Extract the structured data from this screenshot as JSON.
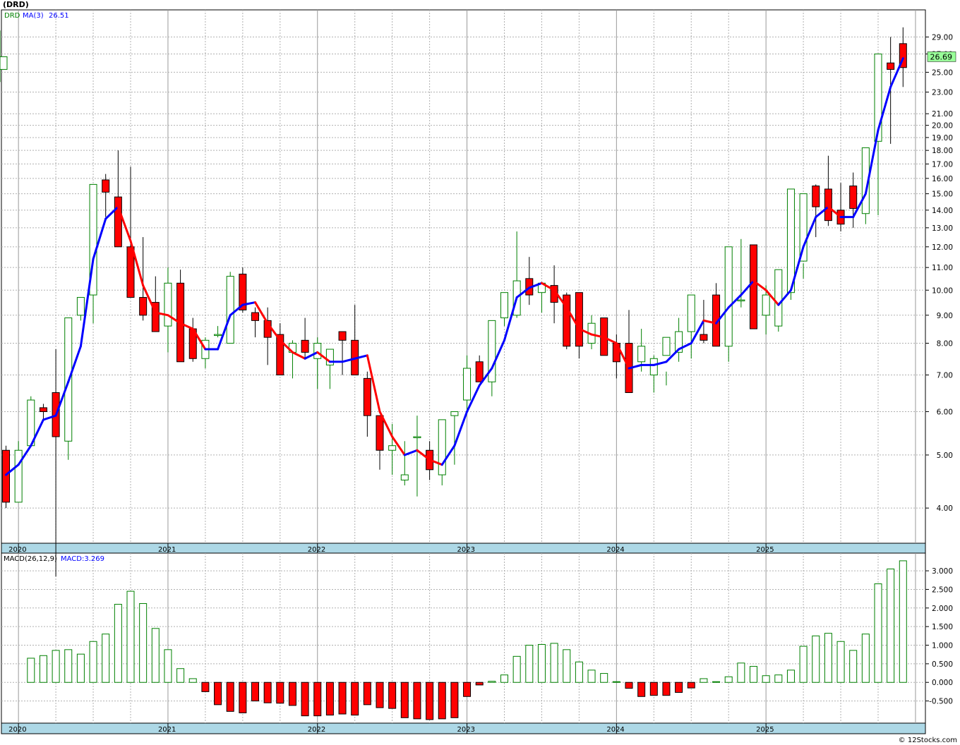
{
  "ticker_label": "(DRD)",
  "credit": "© 12Stocks.com",
  "price_legend": {
    "symbol": "DRD",
    "ma_label": "MA(3)",
    "ma_value": "26.51"
  },
  "last_price_label": "26.69",
  "macd_legend": {
    "label": "MACD(26,12,9)",
    "value_label": "MACD:3.269"
  },
  "year_labels": [
    "2020",
    "2021",
    "2022",
    "2023",
    "2024",
    "2025"
  ],
  "colors": {
    "up_candle": "#008000",
    "down_candle": "#ff0000",
    "ma_up": "#0000ff",
    "ma_down": "#ff0000",
    "axis_band": "#add8e6",
    "grid": "#b0b0b0"
  },
  "chart_data": [
    {
      "type": "candlestick",
      "scale": "log",
      "interval": "monthly",
      "ylim": [
        3.5,
        30.0
      ],
      "y_ticks": [
        "4.00",
        "5.00",
        "6.00",
        "7.00",
        "8.00",
        "9.00",
        "10.00",
        "11.00",
        "12.00",
        "13.00",
        "14.00",
        "15.00",
        "16.00",
        "17.00",
        "18.00",
        "19.00",
        "20.00",
        "21.00",
        "23.00",
        "25.00",
        "27.00",
        "29.00"
      ],
      "x_ticks": [
        "2020",
        "2021",
        "2022",
        "2023",
        "2024",
        "2025"
      ],
      "x": [
        "2019-12",
        "2020-01",
        "2020-02",
        "2020-03",
        "2020-04",
        "2020-05",
        "2020-06",
        "2020-07",
        "2020-08",
        "2020-09",
        "2020-10",
        "2020-11",
        "2020-12",
        "2021-01",
        "2021-02",
        "2021-03",
        "2021-04",
        "2021-05",
        "2021-06",
        "2021-07",
        "2021-08",
        "2021-09",
        "2021-10",
        "2021-11",
        "2021-12",
        "2022-01",
        "2022-02",
        "2022-03",
        "2022-04",
        "2022-05",
        "2022-06",
        "2022-07",
        "2022-08",
        "2022-09",
        "2022-10",
        "2022-11",
        "2022-12",
        "2023-01",
        "2023-02",
        "2023-03",
        "2023-04",
        "2023-05",
        "2023-06",
        "2023-07",
        "2023-08",
        "2023-09",
        "2023-10",
        "2023-11",
        "2023-12",
        "2024-01",
        "2024-02",
        "2024-03",
        "2024-04",
        "2024-05",
        "2024-06",
        "2024-07",
        "2024-08",
        "2024-09",
        "2024-10",
        "2024-11",
        "2024-12",
        "2025-01",
        "2025-02",
        "2025-03",
        "2025-04",
        "2025-05",
        "2025-06",
        "2025-07",
        "2025-08",
        "2025-09",
        "2025-10",
        "2025-11",
        "2025-12"
      ],
      "open": [
        5.1,
        4.1,
        5.2,
        6.1,
        6.5,
        5.3,
        9.0,
        9.8,
        15.9,
        14.8,
        12.0,
        9.7,
        9.5,
        8.6,
        10.3,
        8.5,
        7.5,
        8.3,
        8.0,
        10.7,
        9.1,
        8.8,
        8.3,
        7.7,
        8.1,
        7.5,
        7.3,
        8.4,
        8.1,
        6.9,
        5.9,
        5.1,
        4.5,
        5.4,
        5.1,
        4.6,
        5.9,
        6.3,
        7.4,
        6.8,
        8.9,
        9.0,
        10.5,
        9.9,
        10.2,
        9.8,
        9.9,
        8.0,
        8.9,
        8.0,
        8.0,
        7.4,
        7.0,
        7.6,
        7.7,
        8.4,
        8.3,
        9.8,
        7.9,
        9.6,
        12.1,
        9.0,
        8.6,
        9.9,
        11.3,
        15.5,
        15.3,
        14.0,
        15.5,
        13.8,
        18.7,
        26.0,
        28.2,
        25.3
      ],
      "high": [
        5.2,
        5.3,
        6.4,
        6.2,
        7.8,
        7.8,
        9.7,
        10.5,
        16.3,
        18.0,
        16.8,
        12.5,
        10.6,
        11.0,
        10.9,
        8.9,
        8.2,
        8.6,
        10.8,
        11.0,
        9.3,
        9.3,
        8.7,
        8.1,
        8.9,
        8.2,
        7.7,
        8.1,
        9.4,
        7.1,
        5.9,
        5.7,
        5.3,
        5.9,
        5.3,
        5.1,
        6.0,
        7.6,
        7.6,
        7.2,
        9.8,
        12.8,
        11.5,
        10.3,
        11.1,
        9.9,
        9.1,
        9.0,
        8.4,
        8.3,
        9.2,
        8.5,
        7.6,
        7.1,
        8.9,
        9.1,
        9.6,
        10.3,
        10.1,
        12.4,
        12.1,
        10.2,
        9.0,
        10.2,
        11.2,
        15.6,
        17.6,
        15.7,
        16.4,
        15.0,
        18.8,
        29.0,
        30.2,
        29.8
      ],
      "low": [
        4.0,
        4.1,
        5.2,
        5.8,
        3.0,
        4.9,
        8.8,
        8.7,
        13.6,
        14.2,
        11.3,
        8.8,
        9.1,
        7.7,
        8.3,
        7.4,
        7.2,
        8.2,
        8.0,
        9.1,
        8.2,
        7.3,
        7.0,
        6.9,
        7.5,
        6.6,
        6.6,
        7.0,
        7.0,
        5.4,
        4.7,
        4.6,
        4.4,
        4.2,
        4.5,
        4.4,
        4.8,
        6.0,
        6.9,
        6.4,
        8.6,
        8.9,
        9.4,
        9.1,
        8.7,
        7.8,
        7.5,
        7.8,
        7.6,
        6.9,
        6.6,
        7.1,
        6.5,
        6.7,
        7.4,
        7.5,
        8.0,
        8.4,
        7.4,
        9.3,
        8.9,
        8.3,
        8.4,
        9.6,
        10.5,
        12.5,
        13.1,
        12.8,
        13.0,
        13.2,
        13.7,
        18.5,
        23.5,
        24.0
      ],
      "close": [
        4.1,
        5.1,
        6.3,
        6.0,
        5.4,
        8.9,
        9.7,
        15.6,
        15.1,
        12.0,
        9.7,
        9.0,
        8.4,
        10.3,
        7.4,
        7.5,
        8.1,
        8.3,
        10.6,
        9.2,
        8.8,
        8.2,
        7.0,
        8.0,
        7.7,
        8.0,
        7.8,
        8.1,
        7.0,
        5.9,
        5.1,
        5.2,
        4.6,
        5.4,
        4.7,
        5.8,
        6.0,
        7.2,
        6.8,
        8.8,
        9.9,
        10.4,
        9.8,
        10.3,
        9.5,
        7.9,
        7.9,
        8.7,
        7.6,
        7.4,
        6.5,
        7.9,
        7.5,
        8.2,
        8.4,
        9.8,
        8.1,
        7.9,
        12.0,
        9.6,
        8.5,
        9.8,
        10.9,
        15.3,
        15.0,
        14.2,
        13.4,
        13.2,
        14.1,
        18.2,
        27.0,
        25.3,
        25.5,
        26.69
      ],
      "ma": [
        {
          "name": "MA(3)",
          "values": [
            4.6,
            4.8,
            5.2,
            5.8,
            5.9,
            6.8,
            7.9,
            11.4,
            13.5,
            14.2,
            12.3,
            10.2,
            9.1,
            9.0,
            8.7,
            8.5,
            7.8,
            7.8,
            9.0,
            9.4,
            9.5,
            8.7,
            8.1,
            7.7,
            7.5,
            7.7,
            7.4,
            7.4,
            7.5,
            7.6,
            6.0,
            5.4,
            5.0,
            5.1,
            4.9,
            4.8,
            5.2,
            6.0,
            6.7,
            7.2,
            8.1,
            9.7,
            10.1,
            10.3,
            10.0,
            9.3,
            8.5,
            8.3,
            8.2,
            8.0,
            7.2,
            7.3,
            7.3,
            7.4,
            7.8,
            8.0,
            8.8,
            8.7,
            9.3,
            9.8,
            10.4,
            10.0,
            9.4,
            10.0,
            12.0,
            13.6,
            14.2,
            13.6,
            13.6,
            15.0,
            19.6,
            23.5,
            26.51
          ]
        }
      ]
    },
    {
      "type": "bar",
      "title": "MACD(26,12,9)",
      "ylim": [
        -1.0,
        3.4
      ],
      "y_ticks": [
        "-0.500",
        "0.000",
        "0.500",
        "1.000",
        "1.500",
        "2.000",
        "2.500",
        "3.000"
      ],
      "x_ticks": [
        "2020",
        "2021",
        "2022",
        "2023",
        "2024",
        "2025"
      ],
      "values": [
        0.65,
        0.72,
        0.86,
        0.88,
        0.76,
        1.1,
        1.3,
        2.1,
        2.45,
        2.12,
        1.45,
        0.88,
        0.37,
        0.1,
        -0.25,
        -0.6,
        -0.78,
        -0.82,
        -0.5,
        -0.55,
        -0.56,
        -0.62,
        -0.9,
        -0.9,
        -0.88,
        -0.85,
        -0.88,
        -0.6,
        -0.68,
        -0.7,
        -0.95,
        -0.98,
        -1.0,
        -0.98,
        -0.95,
        -0.38,
        -0.07,
        0.03,
        0.2,
        0.7,
        1.0,
        1.02,
        1.05,
        0.88,
        0.55,
        0.33,
        0.24,
        0.02,
        -0.16,
        -0.38,
        -0.35,
        -0.35,
        -0.27,
        -0.15,
        0.1,
        0.02,
        0.15,
        0.52,
        0.43,
        0.18,
        0.2,
        0.33,
        0.97,
        1.25,
        1.32,
        1.1,
        0.86,
        1.3,
        2.65,
        3.05,
        3.269
      ]
    }
  ]
}
